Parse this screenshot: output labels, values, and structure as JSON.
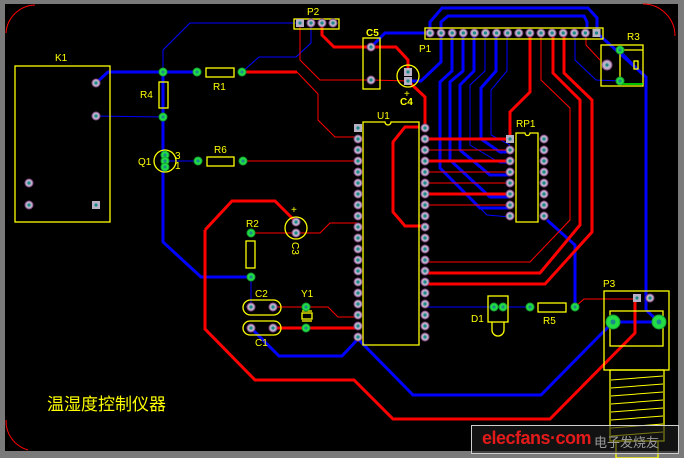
{
  "board": {
    "title_text": "温湿度控制仪器",
    "background_color": "#000000",
    "frame_color": "#7a7a7a",
    "top_layer_color": "#ff0000",
    "bottom_layer_color": "#0000ff",
    "silkscreen_color": "#ffff00"
  },
  "components": {
    "K1": "K1",
    "P2": "P2",
    "R1": "R1",
    "R4": "R4",
    "Q1": "Q1",
    "Q1_pin3": "3",
    "Q1_pin1": "1",
    "R6": "R6",
    "R2": "R2",
    "C3": "C3",
    "C3_plus": "+",
    "C2": "C2",
    "C1": "C1",
    "Y1": "Y1",
    "U1": "U1",
    "C5": "C5",
    "C4": "C4",
    "C4_plus": "+",
    "P1": "P1",
    "RP1": "RP1",
    "R3": "R3",
    "D1": "D1",
    "R5": "R5",
    "P3": "P3"
  },
  "watermark": {
    "brand": "elecfans·com",
    "chinese": "电子发烧友"
  }
}
